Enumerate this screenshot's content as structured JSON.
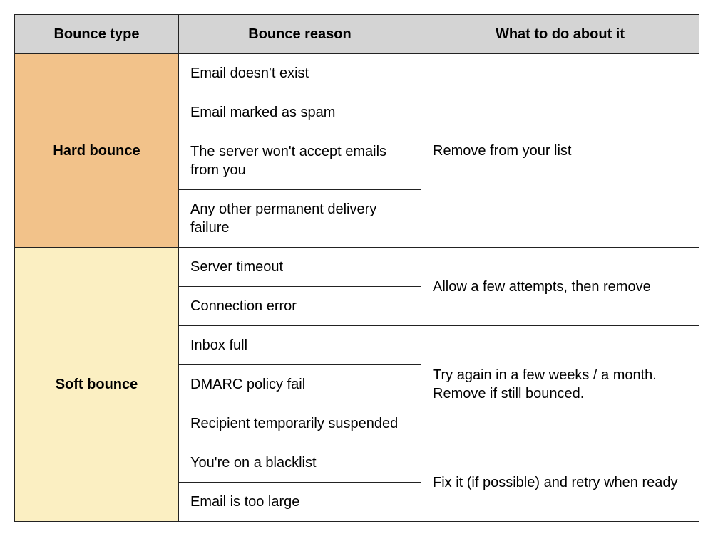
{
  "headers": {
    "type": "Bounce type",
    "reason": "Bounce reason",
    "action": "What to do about it"
  },
  "hard": {
    "label": "Hard bounce",
    "reasons": [
      "Email doesn't exist",
      "Email marked as spam",
      "The server won't accept emails from you",
      "Any other permanent delivery failure"
    ],
    "action": "Remove from your list"
  },
  "soft": {
    "label": "Soft bounce",
    "groups": [
      {
        "reasons": [
          "Server timeout",
          "Connection error"
        ],
        "action": "Allow a few attempts, then remove"
      },
      {
        "reasons": [
          "Inbox full",
          "DMARC policy fail",
          "Recipient temporarily suspended"
        ],
        "action": "Try again in a few weeks / a month. Remove if still bounced."
      },
      {
        "reasons": [
          "You're on a blacklist",
          "Email is too large"
        ],
        "action": "Fix it (if possible) and retry when ready"
      }
    ]
  }
}
